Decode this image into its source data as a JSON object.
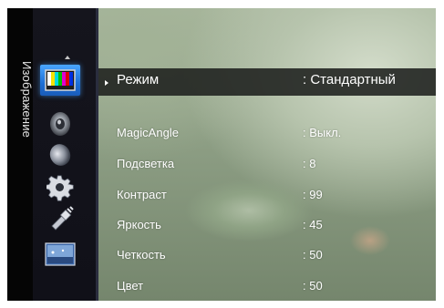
{
  "sidebar": {
    "section_title": "Изображение",
    "icons": [
      {
        "name": "picture-icon",
        "active": true
      },
      {
        "name": "sound-icon",
        "active": false
      },
      {
        "name": "channel-icon",
        "active": false
      },
      {
        "name": "setup-icon",
        "active": false
      },
      {
        "name": "input-icon",
        "active": false
      },
      {
        "name": "application-icon",
        "active": false
      }
    ]
  },
  "menu": {
    "items": [
      {
        "label": "Режим",
        "value": ": Стандартный"
      },
      {
        "label": "MagicAngle",
        "value": ": Выкл."
      },
      {
        "label": "Подсветка",
        "value": ": 8"
      },
      {
        "label": "Контраст",
        "value": ": 99"
      },
      {
        "label": "Яркость",
        "value": ": 45"
      },
      {
        "label": "Четкость",
        "value": ": 50"
      },
      {
        "label": "Цвет",
        "value": ": 50"
      }
    ]
  },
  "colors": {
    "accent_blue": "#1d6fd6",
    "text": "#ffffff",
    "panel": "#101018"
  }
}
